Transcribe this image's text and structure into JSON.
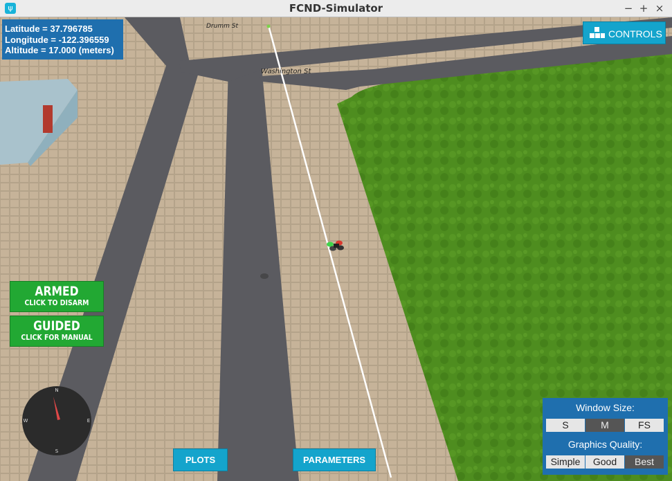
{
  "window": {
    "title": "FCND-Simulator",
    "minimize": "−",
    "maximize": "+",
    "close": "×"
  },
  "telemetry": {
    "latitude": "Latitude = 37.796785",
    "longitude": "Longitude = -122.396559",
    "altitude": "Altitude = 17.000 (meters)"
  },
  "street_labels": {
    "drumm": "Drumm St",
    "washington": "Washington St"
  },
  "controls": {
    "label": "CONTROLS",
    "icon": "blocks-icon"
  },
  "armed": {
    "title": "ARMED",
    "subtitle": "CLICK TO DISARM"
  },
  "guided": {
    "title": "GUIDED",
    "subtitle": "CLICK FOR MANUAL"
  },
  "compass": {
    "n": "N",
    "s": "S",
    "e": "E",
    "w": "W"
  },
  "bottom": {
    "plots": "PLOTS",
    "parameters": "PARAMETERS"
  },
  "settings": {
    "window_size_label": "Window Size:",
    "window_sizes": [
      "S",
      "M",
      "FS"
    ],
    "window_size_selected": "M",
    "quality_label": "Graphics Quality:",
    "qualities": [
      "Simple",
      "Good",
      "Best"
    ],
    "quality_selected": "Best"
  },
  "colors": {
    "accent": "#14a4cc",
    "panel": "#1f6fae",
    "armed_green": "#22a833",
    "grass": "#4f8f1e",
    "road": "#5a5a5e",
    "pavement": "#c9b79e"
  }
}
